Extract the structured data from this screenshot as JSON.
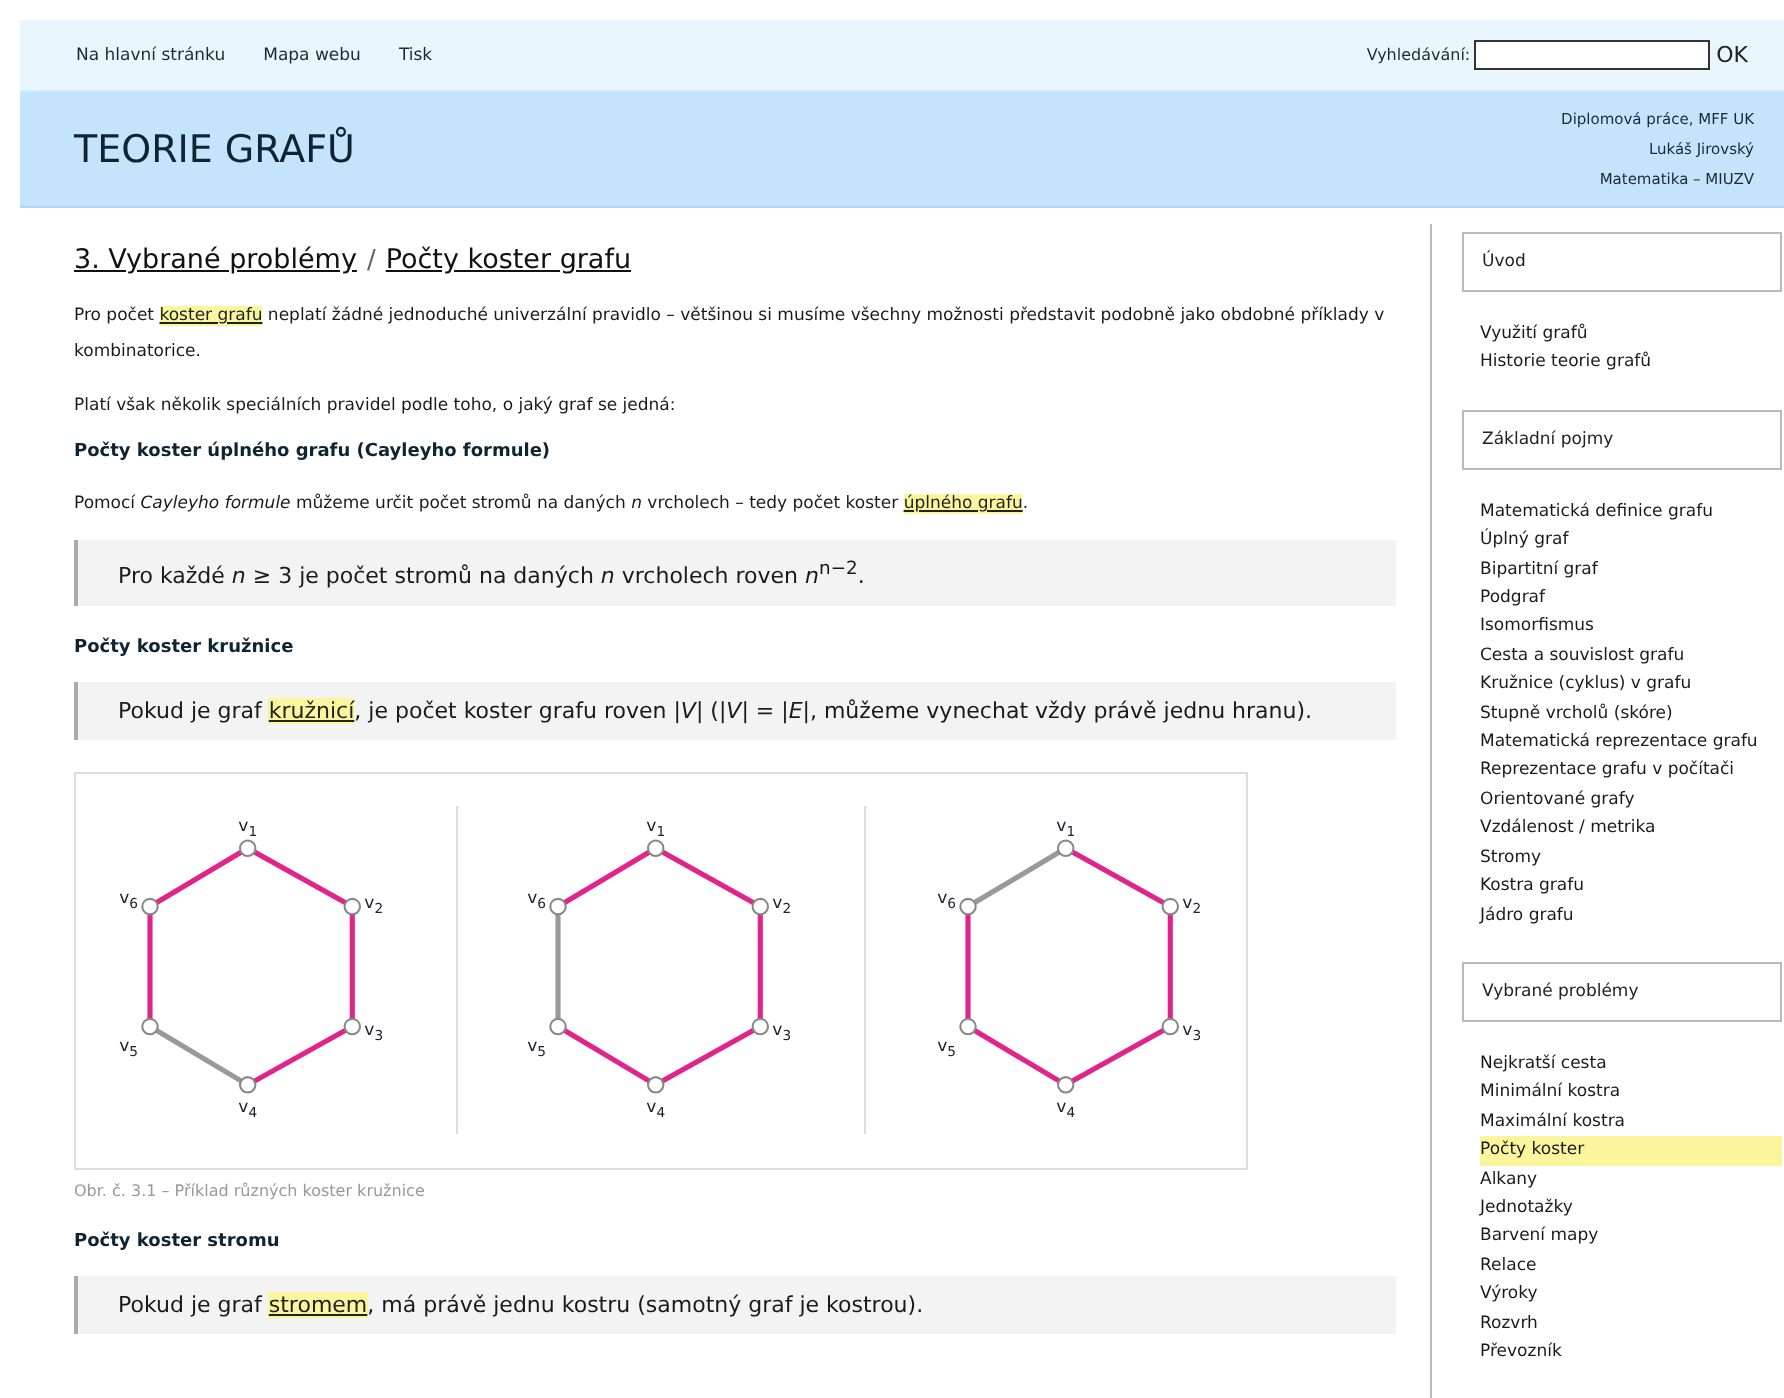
{
  "nav": {
    "links": [
      "Na hlavní stránku",
      "Mapa webu",
      "Tisk"
    ],
    "search_label": "Vyhledávání:",
    "search_button": "OK"
  },
  "header": {
    "title": "TEORIE GRAFŮ",
    "info": [
      "Diplomová práce, MFF UK",
      "Lukáš Jirovský",
      "Matematika – MIUZV"
    ]
  },
  "breadcrumb": {
    "items": [
      "3. Vybrané problémy",
      "Počty koster grafu"
    ],
    "separator": "/"
  },
  "content": [
    {
      "kind": "paragraph",
      "parts": [
        {
          "kind": "text",
          "text": "Pro počet "
        },
        {
          "kind": "link",
          "text": "koster grafu"
        },
        {
          "kind": "text",
          "text": " neplatí žádné jednoduché univerzální pravidlo – většinou si musíme všechny možnosti představit podobně jako obdobné příklady v kombinatorice."
        }
      ]
    },
    {
      "kind": "paragraph",
      "parts": [
        {
          "kind": "text",
          "text": "Platí však několik speciálních pravidel podle toho, o jaký graf se jedná:"
        }
      ]
    },
    {
      "kind": "heading",
      "text": "Počty koster úplného grafu (Cayleyho formule)"
    },
    {
      "kind": "paragraph",
      "parts": [
        {
          "kind": "text",
          "text": "Pomocí *Cayleyho formule* můžeme určit počet stromů na daných *n* vrcholech – tedy počet koster "
        },
        {
          "kind": "link",
          "text": "úplného grafu"
        },
        {
          "kind": "text",
          "text": "."
        }
      ]
    },
    {
      "kind": "quote",
      "parts": [
        {
          "kind": "text",
          "text": "Pro každé *n* ≥ 3 je počet stromů na daných *n* vrcholech roven *n*$^{n−2}$."
        }
      ]
    },
    {
      "kind": "heading",
      "text": "Počty koster kružnice"
    },
    {
      "kind": "quote",
      "parts": [
        {
          "kind": "text",
          "text": "Pokud je graf "
        },
        {
          "kind": "link",
          "text": "kružnicí"
        },
        {
          "kind": "text",
          "text": ", je počet koster grafu roven |*V*| (|*V*| = |*E*|, můžeme vynechat vždy právě jednu hranu)."
        }
      ]
    },
    {
      "kind": "figure",
      "graphs": [
        {
          "vertices": [
            {
              "name": "v",
              "sub": "1"
            },
            {
              "name": "v",
              "sub": "2"
            },
            {
              "name": "v",
              "sub": "3"
            },
            {
              "name": "v",
              "sub": "4"
            },
            {
              "name": "v",
              "sub": "5"
            },
            {
              "name": "v",
              "sub": "6"
            }
          ],
          "edges": [
            {
              "removed": false
            },
            {
              "removed": false
            },
            {
              "removed": false
            },
            {
              "removed": true
            },
            {
              "removed": false
            },
            {
              "removed": false
            }
          ]
        },
        {
          "vertices": [
            {
              "name": "v",
              "sub": "1"
            },
            {
              "name": "v",
              "sub": "2"
            },
            {
              "name": "v",
              "sub": "3"
            },
            {
              "name": "v",
              "sub": "4"
            },
            {
              "name": "v",
              "sub": "5"
            },
            {
              "name": "v",
              "sub": "6"
            }
          ],
          "edges": [
            {
              "removed": false
            },
            {
              "removed": false
            },
            {
              "removed": false
            },
            {
              "removed": false
            },
            {
              "removed": true
            },
            {
              "removed": false
            }
          ]
        },
        {
          "vertices": [
            {
              "name": "v",
              "sub": "1"
            },
            {
              "name": "v",
              "sub": "2"
            },
            {
              "name": "v",
              "sub": "3"
            },
            {
              "name": "v",
              "sub": "4"
            },
            {
              "name": "v",
              "sub": "5"
            },
            {
              "name": "v",
              "sub": "6"
            }
          ],
          "edges": [
            {
              "removed": false
            },
            {
              "removed": false
            },
            {
              "removed": false
            },
            {
              "removed": false
            },
            {
              "removed": false
            },
            {
              "removed": true
            }
          ]
        }
      ]
    },
    {
      "kind": "caption",
      "text": "Obr. č. 3.1 – Příklad různých koster kružnice"
    },
    {
      "kind": "heading",
      "text": "Počty koster stromu"
    },
    {
      "kind": "quote",
      "parts": [
        {
          "kind": "text",
          "text": "Pokud je graf "
        },
        {
          "kind": "link",
          "text": "stromem"
        },
        {
          "kind": "text",
          "text": ", má právě jednu kostru (samotný graf je kostrou)."
        }
      ]
    }
  ],
  "sidebar": {
    "sections": [
      {
        "title": "Úvod",
        "items": [
          {
            "label": "Využití grafů",
            "selected": false
          },
          {
            "label": "Historie teorie grafů",
            "selected": false
          }
        ]
      },
      {
        "title": "Základní pojmy",
        "items": [
          {
            "label": "Matematická definice grafu",
            "selected": false
          },
          {
            "label": "Úplný graf",
            "selected": false
          },
          {
            "label": "Bipartitní graf",
            "selected": false
          },
          {
            "label": "Podgraf",
            "selected": false
          },
          {
            "label": "Isomorfismus",
            "selected": false
          },
          {
            "label": "Cesta a souvislost grafu",
            "selected": false
          },
          {
            "label": "Kružnice (cyklus) v grafu",
            "selected": false
          },
          {
            "label": "Stupně vrcholů (skóre)",
            "selected": false
          },
          {
            "label": "Matematická reprezentace grafu",
            "selected": false
          },
          {
            "label": "Reprezentace grafu v počítači",
            "selected": false
          },
          {
            "label": "Orientované grafy",
            "selected": false
          },
          {
            "label": "Vzdálenost / metrika",
            "selected": false
          },
          {
            "label": "Stromy",
            "selected": false
          },
          {
            "label": "Kostra grafu",
            "selected": false
          },
          {
            "label": "Jádro grafu",
            "selected": false
          }
        ]
      },
      {
        "title": "Vybrané problémy",
        "items": [
          {
            "label": "Nejkratší cesta",
            "selected": false
          },
          {
            "label": "Minimální kostra",
            "selected": false
          },
          {
            "label": "Maximální kostra",
            "selected": false
          },
          {
            "label": "Počty koster",
            "selected": true
          },
          {
            "label": "Alkany",
            "selected": false
          },
          {
            "label": "Jednotažky",
            "selected": false
          },
          {
            "label": "Barvení mapy",
            "selected": false
          },
          {
            "label": "Relace",
            "selected": false
          },
          {
            "label": "Výroky",
            "selected": false
          },
          {
            "label": "Rozvrh",
            "selected": false
          },
          {
            "label": "Převozník",
            "selected": false
          }
        ]
      }
    ]
  }
}
